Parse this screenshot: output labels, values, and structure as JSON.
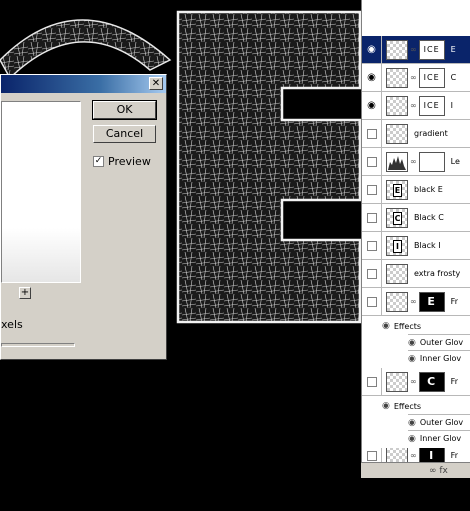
{
  "dialog": {
    "close_glyph": "✕",
    "ok_label": "OK",
    "cancel_label": "Cancel",
    "preview_label": "Preview",
    "preview_checked_glyph": "✓",
    "zoom_plus": "+",
    "pixels_label": "xels"
  },
  "canvas": {
    "letter": "E",
    "arch_label": "C"
  },
  "layers": [
    {
      "name": "E",
      "mask_text": "ICE",
      "visible": true,
      "selected": true
    },
    {
      "name": "C",
      "mask_text": "ICE",
      "visible": true,
      "selected": false
    },
    {
      "name": "I",
      "mask_text": "ICE",
      "visible": true,
      "selected": false
    },
    {
      "name": "gradient",
      "visible": false,
      "selected": false
    },
    {
      "name": "Le",
      "visible": false,
      "selected": false
    },
    {
      "name": "black E",
      "thumb_letter": "E",
      "visible": false,
      "selected": false
    },
    {
      "name": "Black C",
      "thumb_letter": "C",
      "visible": false,
      "selected": false
    },
    {
      "name": "Black I",
      "thumb_letter": "I",
      "visible": false,
      "selected": false
    },
    {
      "name": "extra frosty",
      "visible": false,
      "selected": false
    },
    {
      "name": "Fr",
      "mask_letter": "E",
      "visible": false,
      "selected": false
    },
    {
      "name": "Fr",
      "mask_letter": "C",
      "visible": false,
      "selected": false
    },
    {
      "name": "Fr",
      "mask_letter": "I",
      "visible": false,
      "selected": false
    }
  ],
  "effects": {
    "group_label": "Effects",
    "outer_glow": "Outer Glov",
    "inner_glow": "Inner Glov"
  },
  "footer": {
    "icons_text": "∞ fx"
  },
  "eye_glyph": "◉",
  "colors": {
    "selection": "#0a246a",
    "dialog_bg": "#d4d0c8",
    "canvas_bg": "#000000"
  }
}
